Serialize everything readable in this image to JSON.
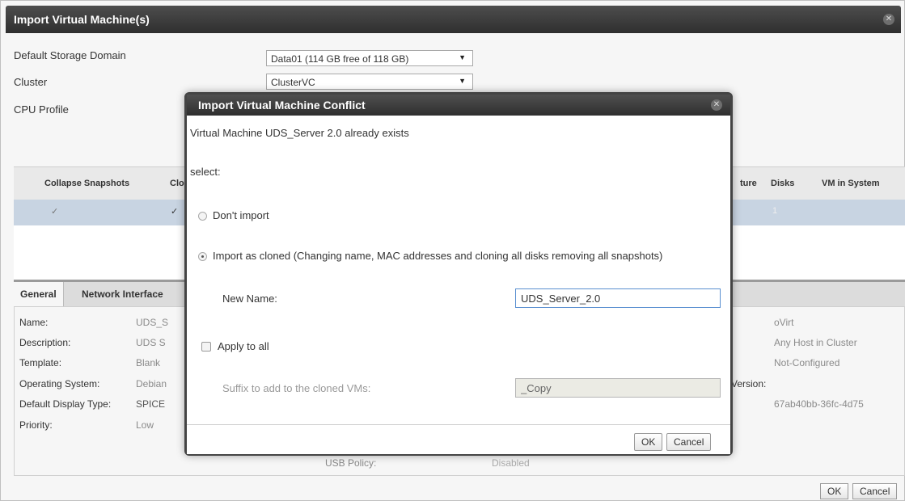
{
  "outer_dialog": {
    "title": "Import Virtual Machine(s)",
    "close_symbol": "✕",
    "default_storage_label": "Default Storage Domain",
    "default_storage_value": "Data01 (114 GB free of 118 GB)",
    "cluster_label": "Cluster",
    "cluster_value": "ClusterVC",
    "cpu_profile_label": "CPU Profile",
    "grid": {
      "columns": {
        "collapse_snapshots": "Collapse Snapshots",
        "clone_partial": "Clo",
        "architecture_partial": "ture",
        "disks": "Disks",
        "vm_in_system": "VM in System"
      },
      "row": {
        "collapse_snapshots": "✓",
        "clone": "✓",
        "disks": "1"
      }
    },
    "tabs": {
      "general": "General",
      "network_interfaces": "Network Interface"
    },
    "properties": [
      {
        "label": "Name:",
        "value": "UDS_S"
      },
      {
        "label": "Description:",
        "value": "UDS S"
      },
      {
        "label": "Template:",
        "value": "Blank"
      },
      {
        "label": "Operating System:",
        "value": "Debian"
      },
      {
        "label": "Default Display Type:",
        "value": "SPICE"
      },
      {
        "label": "Priority:",
        "value": "Low"
      }
    ],
    "right_values": [
      "oVirt",
      "Any Host in Cluster",
      "Not-Configured",
      "67ab40bb-36fc-4d75"
    ],
    "version_label": "Version:",
    "usb_policy_label": "USB Policy:",
    "usb_policy_value": "Disabled",
    "ok_label": "OK",
    "cancel_label": "Cancel"
  },
  "conflict_dialog": {
    "title": "Import Virtual Machine Conflict",
    "close_symbol": "✕",
    "message": "Virtual Machine UDS_Server 2.0 already exists",
    "select_label": "select:",
    "option_dont_import": "Don't import",
    "option_import_cloned": "Import as cloned (Changing name, MAC addresses and cloning all disks removing all snapshots)",
    "new_name_label": "New Name:",
    "new_name_value": "UDS_Server_2.0",
    "apply_to_all_label": "Apply to all",
    "suffix_label": "Suffix to add to the cloned VMs:",
    "suffix_value": "_Copy",
    "ok_label": "OK",
    "cancel_label": "Cancel",
    "selected_option": "import_cloned"
  },
  "colors": {
    "titlebar": "#3a3a3a",
    "selected_row": "#c8d4e2",
    "input_focus_border": "#5a8fd0"
  }
}
